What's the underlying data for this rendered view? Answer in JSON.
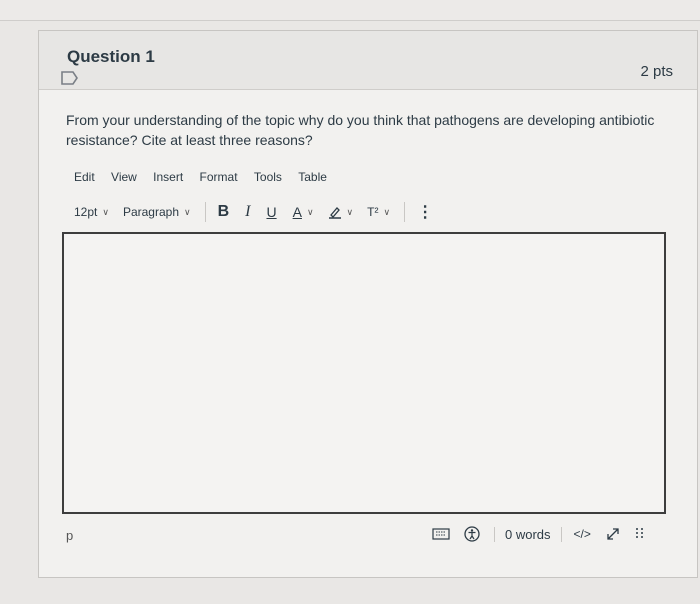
{
  "question": {
    "title": "Question 1",
    "points": "2 pts",
    "prompt": "From your understanding of the topic why do you think that pathogens are developing antibiotic resistance? Cite at least three reasons?"
  },
  "editor": {
    "menu": [
      "Edit",
      "View",
      "Insert",
      "Format",
      "Tools",
      "Table"
    ],
    "font_size": "12pt",
    "block_format": "Paragraph",
    "bold": "B",
    "italic": "I",
    "underline": "U",
    "text_color": "A",
    "superscript": "T²",
    "more": "⋮",
    "content": ""
  },
  "status": {
    "path": "p",
    "word_count": "0 words",
    "html_toggle": "</>"
  }
}
